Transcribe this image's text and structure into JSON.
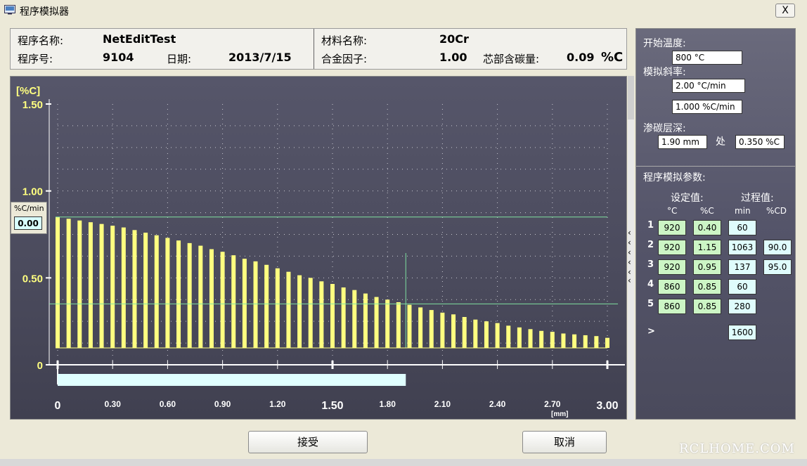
{
  "window": {
    "title": "程序模拟器",
    "close_label": "X"
  },
  "info": {
    "program_name_label": "程序名称:",
    "program_name": "NetEditTest",
    "program_no_label": "程序号:",
    "program_no": "9104",
    "date_label": "日期:",
    "date": "2013/7/15",
    "material_label": "材料名称:",
    "material": "20Cr",
    "alloy_factor_label": "合金因子:",
    "alloy_factor": "1.00",
    "core_carbon_label": "芯部含碳量:",
    "core_carbon": "0.09",
    "core_carbon_unit": "%C"
  },
  "rate_box": {
    "label": "%C/min",
    "value": "0.00"
  },
  "chart_data": {
    "type": "bar",
    "ylabel": "[%C]",
    "xunit": "[mm]",
    "ylim": [
      0,
      1.5
    ],
    "xlim": [
      0,
      3.0
    ],
    "yticks": [
      "0",
      "0.50",
      "1.00",
      "1.50"
    ],
    "xticks": [
      "0",
      "0.30",
      "0.60",
      "0.90",
      "1.20",
      "1.50",
      "1.80",
      "2.10",
      "2.40",
      "2.70",
      "3.00"
    ],
    "x": [
      0.0,
      0.06,
      0.12,
      0.18,
      0.24,
      0.3,
      0.36,
      0.42,
      0.48,
      0.54,
      0.6,
      0.66,
      0.72,
      0.78,
      0.84,
      0.9,
      0.96,
      1.02,
      1.08,
      1.14,
      1.2,
      1.26,
      1.32,
      1.38,
      1.44,
      1.5,
      1.56,
      1.62,
      1.68,
      1.74,
      1.8,
      1.86,
      1.92,
      1.98,
      2.04,
      2.1,
      2.16,
      2.22,
      2.28,
      2.34,
      2.4,
      2.46,
      2.52,
      2.58,
      2.64,
      2.7,
      2.76,
      2.82,
      2.88,
      2.94,
      3.0
    ],
    "values": [
      0.85,
      0.84,
      0.83,
      0.82,
      0.81,
      0.8,
      0.79,
      0.775,
      0.76,
      0.745,
      0.73,
      0.715,
      0.7,
      0.685,
      0.665,
      0.65,
      0.63,
      0.61,
      0.595,
      0.575,
      0.555,
      0.535,
      0.515,
      0.5,
      0.48,
      0.465,
      0.445,
      0.43,
      0.41,
      0.39,
      0.375,
      0.36,
      0.345,
      0.33,
      0.315,
      0.3,
      0.29,
      0.275,
      0.26,
      0.25,
      0.24,
      0.225,
      0.215,
      0.205,
      0.195,
      0.19,
      0.18,
      0.175,
      0.17,
      0.165,
      0.155
    ],
    "ref_line_top": 0.85,
    "ref_line_case": 0.35,
    "case_depth_x": 1.9,
    "progress_bar_to": 1.9,
    "grid": true
  },
  "right": {
    "start_temp_label": "开始温度:",
    "start_temp": "800 °C",
    "slope_label": "模拟斜率:",
    "slope_temp": "2.00 °C/min",
    "slope_carbon": "1.000 %C/min",
    "case_depth_label": "渗碳层深:",
    "case_depth": "1.90 mm",
    "at_label": "处",
    "case_carbon": "0.350 %C",
    "params_title": "程序模拟参数:",
    "set_label": "设定值:",
    "process_label": "过程值:",
    "col_c": "°C",
    "col_pc": "%C",
    "col_min": "min",
    "col_pcd": "%CD",
    "rows": [
      {
        "n": "1",
        "temp": "920",
        "pc": "0.40",
        "min": "60",
        "pcd": ""
      },
      {
        "n": "2",
        "temp": "920",
        "pc": "1.15",
        "min": "1063",
        "pcd": "90.0"
      },
      {
        "n": "3",
        "temp": "920",
        "pc": "0.95",
        "min": "137",
        "pcd": "95.0"
      },
      {
        "n": "4",
        "temp": "860",
        "pc": "0.85",
        "min": "60",
        "pcd": ""
      },
      {
        "n": "5",
        "temp": "860",
        "pc": "0.85",
        "min": "280",
        "pcd": ""
      }
    ],
    "total_marker": ">",
    "total": "1600"
  },
  "buttons": {
    "accept": "接受",
    "cancel": "取消"
  },
  "watermark": "RCLHOME.COM",
  "colors": {
    "bar": "#ffff80",
    "axis_label": "#ffff80",
    "guide_line": "#7ee0a0",
    "progress": "#e0ffff"
  }
}
